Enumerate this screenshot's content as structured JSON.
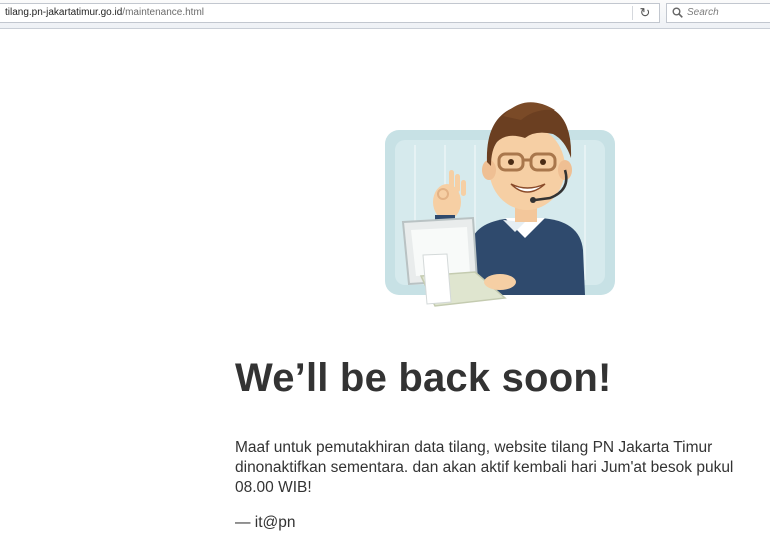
{
  "browser": {
    "url_host": "tilang.pn-jakartatimur.go.id",
    "url_path": "/maintenance.html",
    "search_placeholder": "Search",
    "reload_icon": "reload-icon",
    "search_icon": "search-icon"
  },
  "page": {
    "headline": "We’ll be back soon!",
    "message": "Maaf untuk pemutakhiran data tilang, website tilang PN Jakarta Timur dinonaktifkan sementara. dan akan aktif kembali hari Jum'at besok pukul 08.00 WIB!",
    "signature": "— it@pn"
  },
  "colors": {
    "text": "#333333",
    "panel": "#c9e2e6",
    "sweater": "#2f4a6d"
  }
}
